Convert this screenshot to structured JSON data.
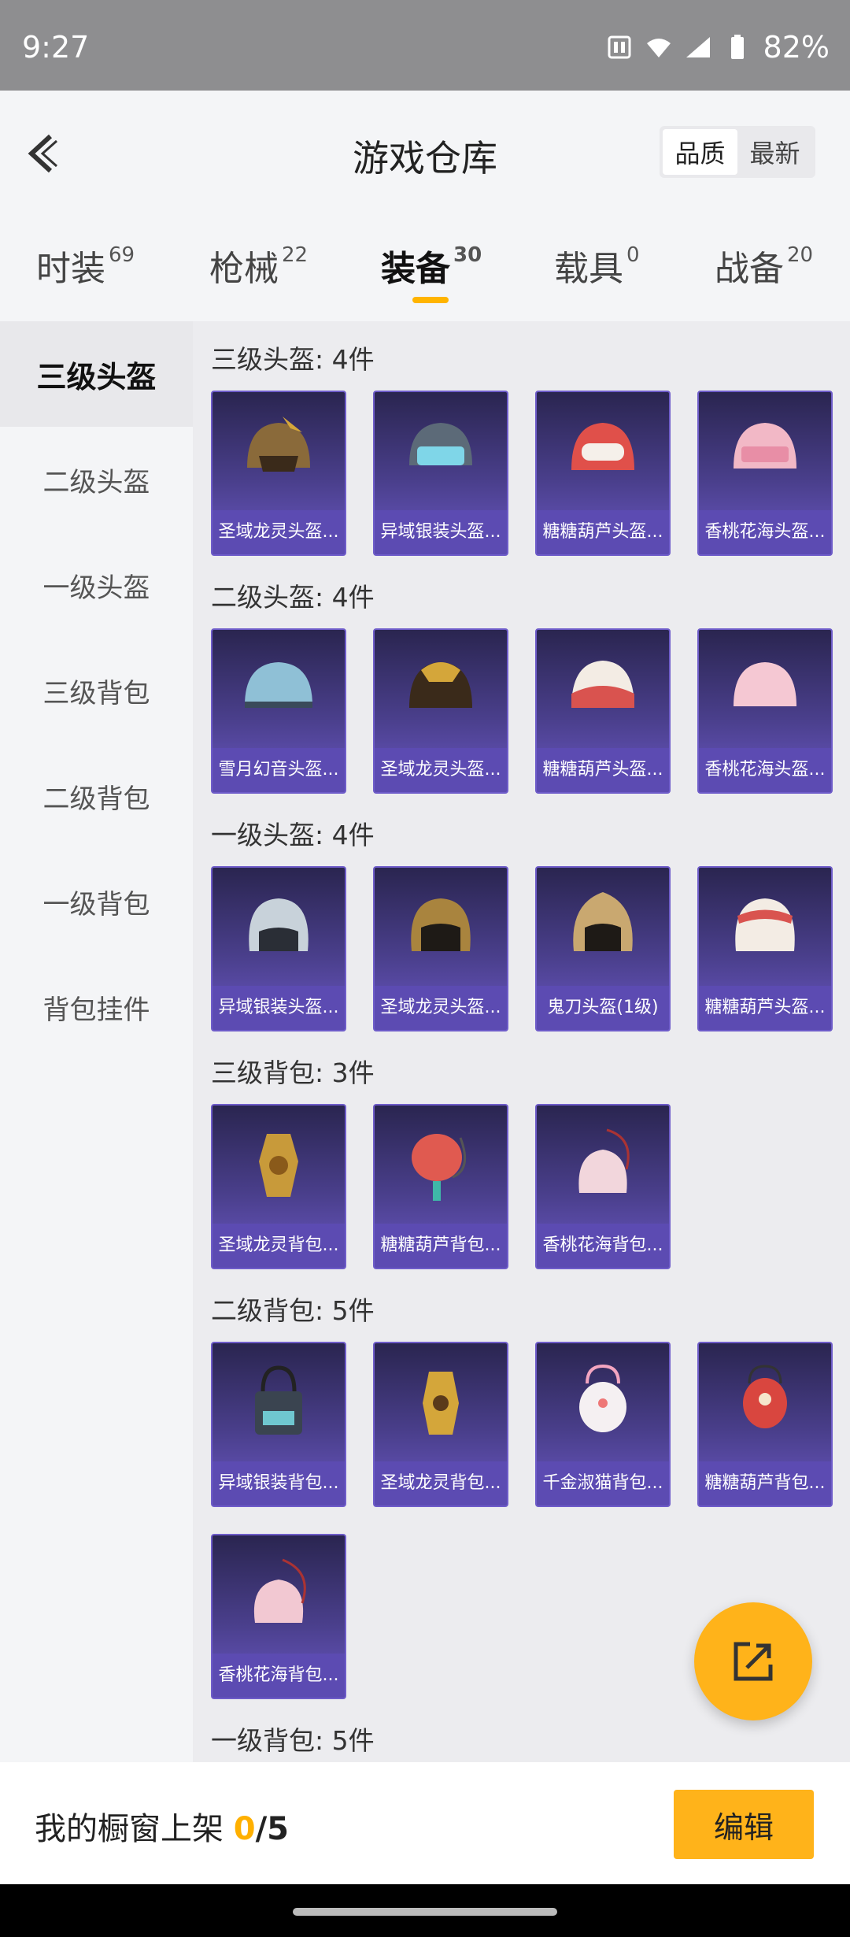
{
  "status": {
    "time": "9:27",
    "battery": "82%"
  },
  "header": {
    "title": "游戏仓库",
    "sort_quality": "品质",
    "sort_latest": "最新"
  },
  "tabs": [
    {
      "label": "时装",
      "count": "69"
    },
    {
      "label": "枪械",
      "count": "22"
    },
    {
      "label": "装备",
      "count": "30"
    },
    {
      "label": "载具",
      "count": "0"
    },
    {
      "label": "战备",
      "count": "20"
    }
  ],
  "sidenav": [
    "三级头盔",
    "二级头盔",
    "一级头盔",
    "三级背包",
    "二级背包",
    "一级背包",
    "背包挂件"
  ],
  "sections": [
    {
      "title": "三级头盔: 4件",
      "items": [
        "圣域龙灵头盔...",
        "异域银装头盔...",
        "糖糖葫芦头盔...",
        "香桃花海头盔..."
      ]
    },
    {
      "title": "二级头盔: 4件",
      "items": [
        "雪月幻音头盔...",
        "圣域龙灵头盔...",
        "糖糖葫芦头盔...",
        "香桃花海头盔..."
      ]
    },
    {
      "title": "一级头盔: 4件",
      "items": [
        "异域银装头盔...",
        "圣域龙灵头盔...",
        "鬼刀头盔(1级)",
        "糖糖葫芦头盔..."
      ]
    },
    {
      "title": "三级背包: 3件",
      "items": [
        "圣域龙灵背包...",
        "糖糖葫芦背包...",
        "香桃花海背包..."
      ]
    },
    {
      "title": "二级背包: 5件",
      "items": [
        "异域银装背包...",
        "圣域龙灵背包...",
        "千金淑猫背包...",
        "糖糖葫芦背包...",
        "香桃花海背包..."
      ]
    },
    {
      "title": "一级背包: 5件",
      "items": []
    }
  ],
  "bottom": {
    "label": "我的橱窗上架 ",
    "shown": "0",
    "total": "/5",
    "edit": "编辑"
  },
  "colors": {
    "accent": "#ffb31a",
    "card_label": "#5c4bb2"
  }
}
